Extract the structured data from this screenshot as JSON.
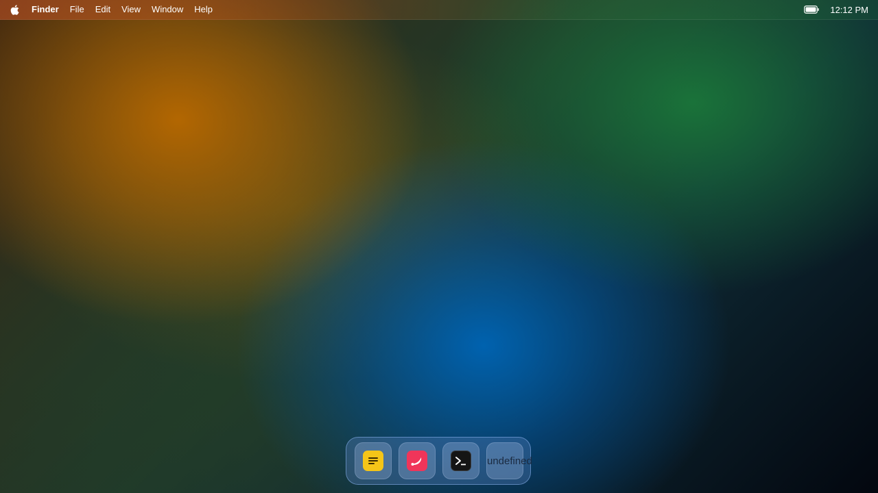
{
  "menubar": {
    "apple_icon": "apple-icon",
    "app_name": "Finder",
    "menus": [
      "File",
      "Edit",
      "View",
      "Window",
      "Help"
    ],
    "battery_icon": "battery-icon",
    "clock": "12:12 PM"
  },
  "dock": {
    "items": [
      {
        "name": "notes",
        "icon": "notes-icon",
        "color": "#f5c518"
      },
      {
        "name": "drawing",
        "icon": "swoosh-icon",
        "color": "#f0355a"
      },
      {
        "name": "terminal",
        "icon": "terminal-icon",
        "color": "#151515"
      },
      {
        "name": "unknown",
        "label": "undefined"
      }
    ]
  }
}
